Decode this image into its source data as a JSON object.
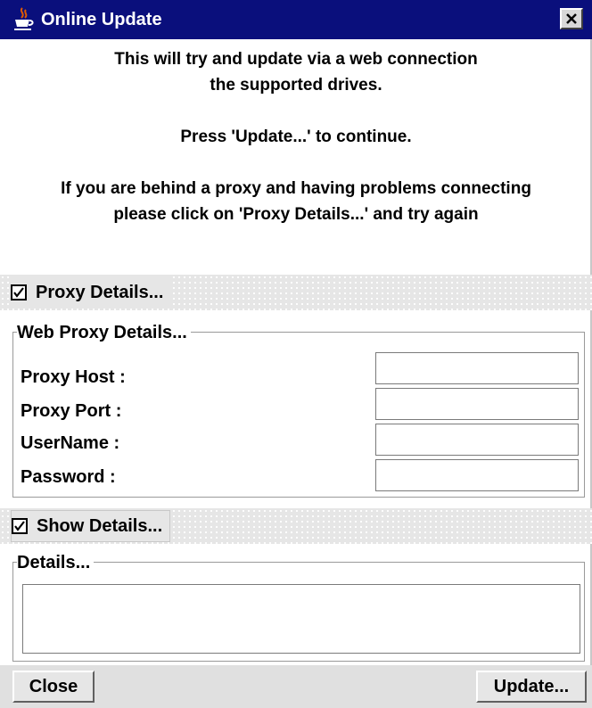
{
  "window": {
    "title": "Online Update",
    "title_bar_color": "#0a0f7c",
    "icon": "java-cup-icon",
    "close_icon": "close-icon"
  },
  "message": {
    "line1a": "This will try and update via a web connection",
    "line1b": "the supported drives.",
    "line2": "Press 'Update...' to continue.",
    "line3a": "If you are behind a proxy and having problems connecting",
    "line3b": "please click on 'Proxy Details...' and try again"
  },
  "proxy_toggle": {
    "label": "Proxy Details...",
    "checked": true
  },
  "proxy_group": {
    "legend": "Web Proxy Details...",
    "fields": [
      {
        "label": "Proxy Host :",
        "value": ""
      },
      {
        "label": "Proxy Port :",
        "value": ""
      },
      {
        "label": "UserName :",
        "value": ""
      },
      {
        "label": "Password :",
        "value": ""
      }
    ]
  },
  "details_toggle": {
    "label": "Show Details...",
    "checked": true
  },
  "details_group": {
    "legend": "Details...",
    "value": ""
  },
  "buttons": {
    "close": "Close",
    "update": "Update..."
  }
}
